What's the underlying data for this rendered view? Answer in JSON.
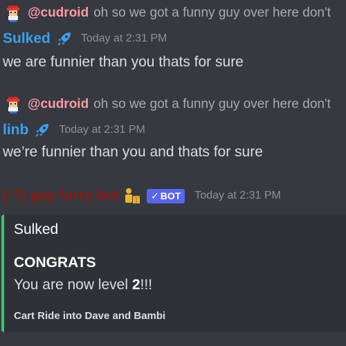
{
  "messages": [
    {
      "reply": {
        "mention": "@cudroid",
        "text": "oh so we got a funny guy over here don't"
      },
      "author": "Sulked",
      "timestamp": "Today at 2:31 PM",
      "content": "we are funnier than you thats for sure"
    },
    {
      "reply": {
        "mention": "@cudroid",
        "text": "oh so we got a funny guy over here don't"
      },
      "author": "linb",
      "timestamp": "Today at 2:31 PM",
      "content": "we’re funnier than you and thats for sure"
    }
  ],
  "bot_message": {
    "author": "(:?) gay furry bot",
    "badge": "BOT",
    "badge_check": "✓",
    "timestamp": "Today at 2:31 PM",
    "embed": {
      "author": "Sulked",
      "title": "CONGRATS",
      "description_prefix": "You are now level ",
      "level": "2",
      "description_suffix": "!!!",
      "footer": "Cart Ride into Dave and Bambi",
      "accent_color": "#2ecc71"
    }
  },
  "colors": {
    "background": "#36393f",
    "mention": "#ff9aa8",
    "author_blue": "#3aa0f0",
    "bot_name": "#8b1a12",
    "bot_badge": "#5865f2"
  },
  "icons": {
    "reply_avatar": "pixel-character-avatar-icon",
    "author_badge": "rocket-icon",
    "bot_role": "person-with-gift-icon"
  }
}
